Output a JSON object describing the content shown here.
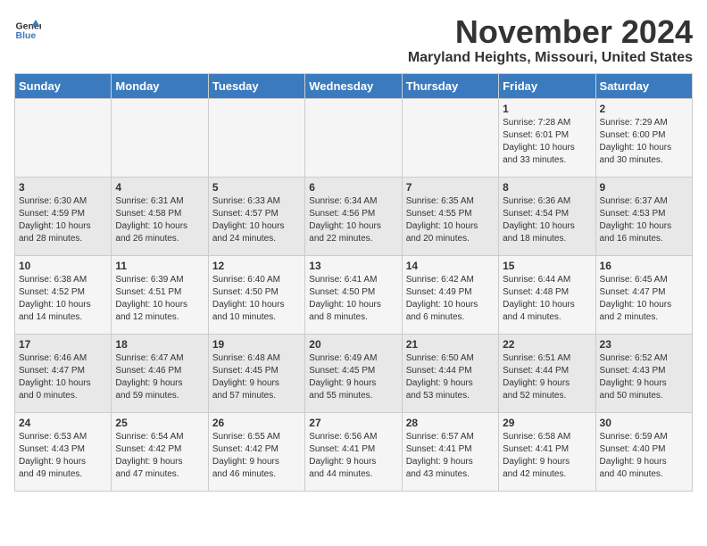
{
  "logo": {
    "general": "General",
    "blue": "Blue"
  },
  "header": {
    "month": "November 2024",
    "location": "Maryland Heights, Missouri, United States"
  },
  "weekdays": [
    "Sunday",
    "Monday",
    "Tuesday",
    "Wednesday",
    "Thursday",
    "Friday",
    "Saturday"
  ],
  "weeks": [
    [
      {
        "day": "",
        "info": ""
      },
      {
        "day": "",
        "info": ""
      },
      {
        "day": "",
        "info": ""
      },
      {
        "day": "",
        "info": ""
      },
      {
        "day": "",
        "info": ""
      },
      {
        "day": "1",
        "info": "Sunrise: 7:28 AM\nSunset: 6:01 PM\nDaylight: 10 hours\nand 33 minutes."
      },
      {
        "day": "2",
        "info": "Sunrise: 7:29 AM\nSunset: 6:00 PM\nDaylight: 10 hours\nand 30 minutes."
      }
    ],
    [
      {
        "day": "3",
        "info": "Sunrise: 6:30 AM\nSunset: 4:59 PM\nDaylight: 10 hours\nand 28 minutes."
      },
      {
        "day": "4",
        "info": "Sunrise: 6:31 AM\nSunset: 4:58 PM\nDaylight: 10 hours\nand 26 minutes."
      },
      {
        "day": "5",
        "info": "Sunrise: 6:33 AM\nSunset: 4:57 PM\nDaylight: 10 hours\nand 24 minutes."
      },
      {
        "day": "6",
        "info": "Sunrise: 6:34 AM\nSunset: 4:56 PM\nDaylight: 10 hours\nand 22 minutes."
      },
      {
        "day": "7",
        "info": "Sunrise: 6:35 AM\nSunset: 4:55 PM\nDaylight: 10 hours\nand 20 minutes."
      },
      {
        "day": "8",
        "info": "Sunrise: 6:36 AM\nSunset: 4:54 PM\nDaylight: 10 hours\nand 18 minutes."
      },
      {
        "day": "9",
        "info": "Sunrise: 6:37 AM\nSunset: 4:53 PM\nDaylight: 10 hours\nand 16 minutes."
      }
    ],
    [
      {
        "day": "10",
        "info": "Sunrise: 6:38 AM\nSunset: 4:52 PM\nDaylight: 10 hours\nand 14 minutes."
      },
      {
        "day": "11",
        "info": "Sunrise: 6:39 AM\nSunset: 4:51 PM\nDaylight: 10 hours\nand 12 minutes."
      },
      {
        "day": "12",
        "info": "Sunrise: 6:40 AM\nSunset: 4:50 PM\nDaylight: 10 hours\nand 10 minutes."
      },
      {
        "day": "13",
        "info": "Sunrise: 6:41 AM\nSunset: 4:50 PM\nDaylight: 10 hours\nand 8 minutes."
      },
      {
        "day": "14",
        "info": "Sunrise: 6:42 AM\nSunset: 4:49 PM\nDaylight: 10 hours\nand 6 minutes."
      },
      {
        "day": "15",
        "info": "Sunrise: 6:44 AM\nSunset: 4:48 PM\nDaylight: 10 hours\nand 4 minutes."
      },
      {
        "day": "16",
        "info": "Sunrise: 6:45 AM\nSunset: 4:47 PM\nDaylight: 10 hours\nand 2 minutes."
      }
    ],
    [
      {
        "day": "17",
        "info": "Sunrise: 6:46 AM\nSunset: 4:47 PM\nDaylight: 10 hours\nand 0 minutes."
      },
      {
        "day": "18",
        "info": "Sunrise: 6:47 AM\nSunset: 4:46 PM\nDaylight: 9 hours\nand 59 minutes."
      },
      {
        "day": "19",
        "info": "Sunrise: 6:48 AM\nSunset: 4:45 PM\nDaylight: 9 hours\nand 57 minutes."
      },
      {
        "day": "20",
        "info": "Sunrise: 6:49 AM\nSunset: 4:45 PM\nDaylight: 9 hours\nand 55 minutes."
      },
      {
        "day": "21",
        "info": "Sunrise: 6:50 AM\nSunset: 4:44 PM\nDaylight: 9 hours\nand 53 minutes."
      },
      {
        "day": "22",
        "info": "Sunrise: 6:51 AM\nSunset: 4:44 PM\nDaylight: 9 hours\nand 52 minutes."
      },
      {
        "day": "23",
        "info": "Sunrise: 6:52 AM\nSunset: 4:43 PM\nDaylight: 9 hours\nand 50 minutes."
      }
    ],
    [
      {
        "day": "24",
        "info": "Sunrise: 6:53 AM\nSunset: 4:43 PM\nDaylight: 9 hours\nand 49 minutes."
      },
      {
        "day": "25",
        "info": "Sunrise: 6:54 AM\nSunset: 4:42 PM\nDaylight: 9 hours\nand 47 minutes."
      },
      {
        "day": "26",
        "info": "Sunrise: 6:55 AM\nSunset: 4:42 PM\nDaylight: 9 hours\nand 46 minutes."
      },
      {
        "day": "27",
        "info": "Sunrise: 6:56 AM\nSunset: 4:41 PM\nDaylight: 9 hours\nand 44 minutes."
      },
      {
        "day": "28",
        "info": "Sunrise: 6:57 AM\nSunset: 4:41 PM\nDaylight: 9 hours\nand 43 minutes."
      },
      {
        "day": "29",
        "info": "Sunrise: 6:58 AM\nSunset: 4:41 PM\nDaylight: 9 hours\nand 42 minutes."
      },
      {
        "day": "30",
        "info": "Sunrise: 6:59 AM\nSunset: 4:40 PM\nDaylight: 9 hours\nand 40 minutes."
      }
    ]
  ]
}
